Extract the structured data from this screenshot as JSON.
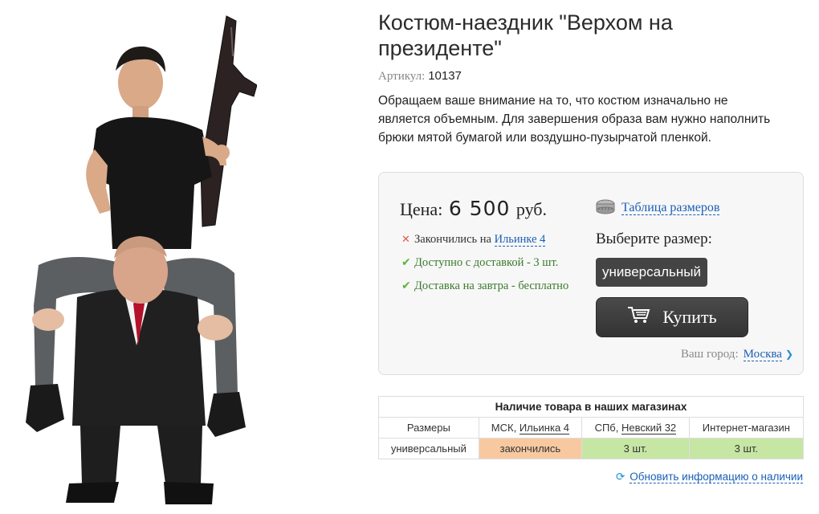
{
  "product": {
    "image_alt": "costume-rider-illustration",
    "title": "Костюм-наездник \"Верхом на президенте\"",
    "article_label": "Артикул:",
    "article_value": "10137",
    "description": "Обращаем ваше внимание на то, что костюм изначально не является объемным. Для завершения образа вам нужно наполнить брюки мятой бумагой или воздушно-пузырчатой пленкой."
  },
  "purchase": {
    "price_label": "Цена:",
    "price_value": "6 500",
    "price_currency": "руб.",
    "stock": [
      {
        "icon": "cross-icon",
        "text": "Закончились на",
        "link": "Ильинке 4"
      },
      {
        "icon": "check-icon",
        "text": "Доступно с доставкой - 3 шт."
      },
      {
        "icon": "check-icon",
        "text": "Доставка на завтра - бесплатно"
      }
    ],
    "size_table_link": "Таблица размеров",
    "choose_size_label": "Выберите размер:",
    "size_option": "универсальный",
    "buy_label": "Купить",
    "city_label": "Ваш город:",
    "city_value": "Москва"
  },
  "availability": {
    "title": "Наличие товара в наших магазинах",
    "headers": [
      "Размеры",
      "МСК,",
      "Ильинка 4",
      "СПб,",
      "Невский 32",
      "Интернет-магазин"
    ],
    "row": [
      "универсальный",
      "закончились",
      "3 шт.",
      "3 шт."
    ],
    "refresh_link": "Обновить информацию о наличии"
  },
  "colors": {
    "link": "#1a5fb4",
    "out_of_stock_cell": "#f8c9a0",
    "in_stock_cell": "#c6e6a4",
    "button_dark": "#444444"
  }
}
